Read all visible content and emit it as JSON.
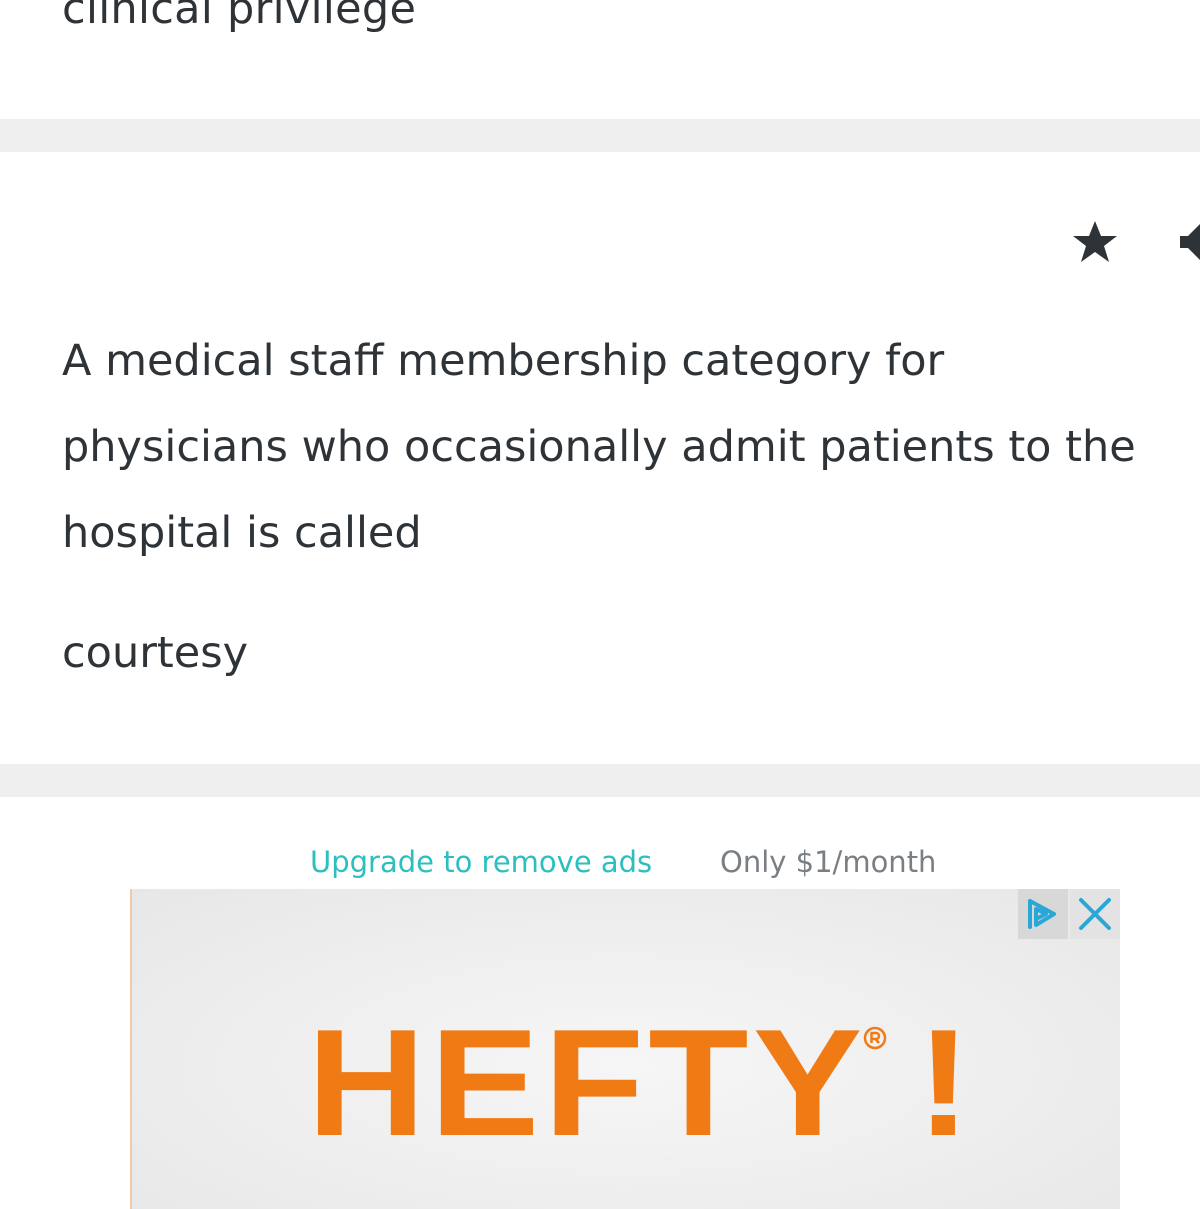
{
  "previous_card": {
    "term": "clinical privilege"
  },
  "current_card": {
    "star_icon": "star-icon",
    "audio_icon": "speaker-icon",
    "definition": "A medical staff membership category for physicians who occasionally admit patients to the hospital is called",
    "answer": "courtesy"
  },
  "ad": {
    "upgrade_label": "Upgrade to remove ads",
    "price_note": "Only $1/month",
    "brand_text": "HEFTY",
    "brand_exclaim": "!",
    "choices_icon": "adchoices-icon",
    "close_icon": "close-icon"
  },
  "colors": {
    "text": "#2e3338",
    "divider": "#efefef",
    "upgrade_link": "#2bbfbf",
    "price_note": "#7a7f84",
    "brand": "#f07a14",
    "adchoices": "#29a8d8"
  }
}
